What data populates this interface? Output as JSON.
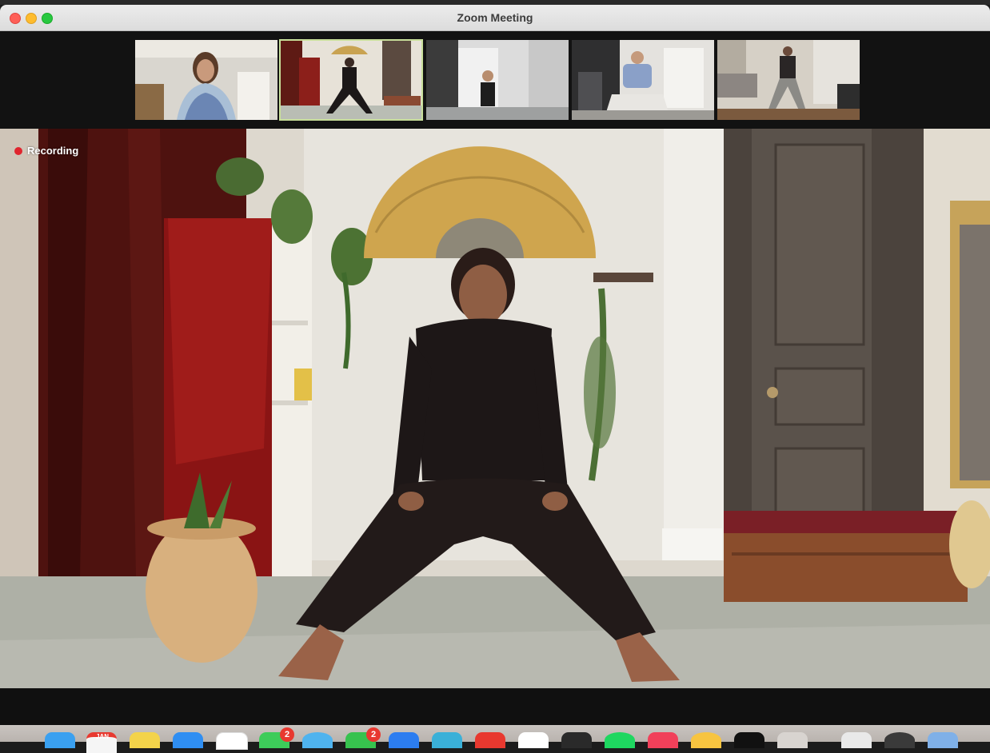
{
  "window": {
    "title": "Zoom Meeting"
  },
  "meeting": {
    "recording_label": "Recording",
    "participant_tile_count": 5,
    "active_speaker_tile": 2
  },
  "colors": {
    "recording_dot": "#e0252e",
    "active_tile_border": "#c8df9a",
    "title_bar": "#e4e4e4"
  },
  "dock": {
    "calendar_label": "JAN",
    "badges": [
      "2",
      "2"
    ],
    "icons": [
      "finder-icon",
      "calendar-icon",
      "notes-icon",
      "mail-icon",
      "reminders-icon",
      "messages-icon",
      "safari-icon",
      "facetime-icon",
      "appstore-icon",
      "maps-icon",
      "photos-icon",
      "news-icon",
      "photos-app-icon",
      "activity-icon",
      "spotify-icon",
      "music-icon",
      "sketch-icon",
      "terminal-icon",
      "pen-icon",
      "preview-icon",
      "quicktime-icon",
      "folder-icon"
    ]
  }
}
